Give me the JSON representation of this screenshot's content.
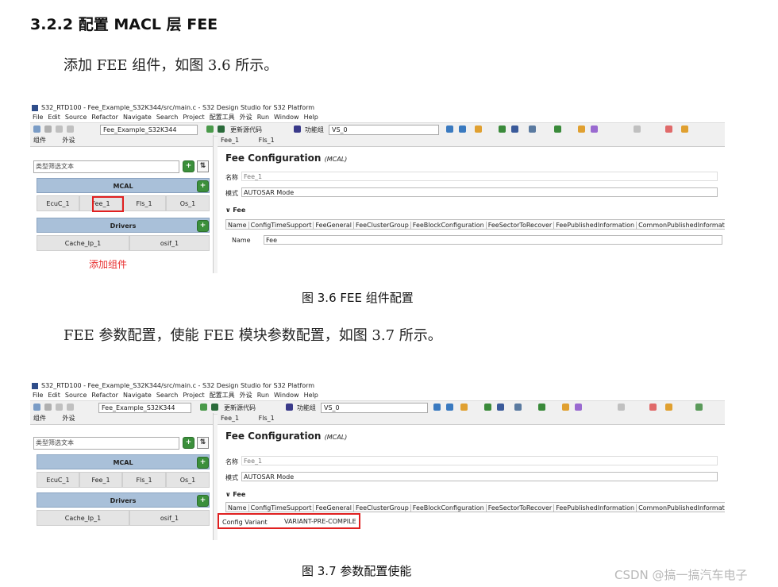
{
  "heading": "3.2.2  配置 MACL 层 FEE",
  "para1": "添加 FEE 组件，如图 3.6 所示。",
  "para2": "FEE 参数配置，使能 FEE 模块参数配置，如图 3.7 所示。",
  "caption1": "图  3.6 FEE 组件配置",
  "caption2": "图  3.7  参数配置使能",
  "watermark": "CSDN @搞一搞汽车电子",
  "ide": {
    "title": "S32_RTD100 - Fee_Example_S32K344/src/main.c - S32 Design Studio for S32 Platform",
    "menus": [
      "File",
      "Edit",
      "Source",
      "Refactor",
      "Navigate",
      "Search",
      "Project",
      "配置工具",
      "外设",
      "Run",
      "Window",
      "Help"
    ],
    "project_combo": "Fee_Example_S32K344",
    "update_code": "更新源代码",
    "func_group_label": "功能组",
    "func_group_value": "VS_0",
    "left_tab1": "组件",
    "left_tab2": "外设",
    "filter_placeholder": "类型筛选文本",
    "group_mcal": "MCAL",
    "mcal_items": [
      "EcuC_1",
      "Fee_1",
      "Fls_1",
      "Os_1"
    ],
    "group_drivers": "Drivers",
    "driver_items": [
      "Cache_Ip_1",
      "osif_1"
    ],
    "add_component": "添加组件",
    "editor_tab1": "Fee_1",
    "editor_tab2": "Fls_1",
    "config_title": "Fee Configuration",
    "config_sub": "(MCAL)",
    "name_label": "名称",
    "name_value": "Fee_1",
    "mode_label": "模式",
    "mode_value": "AUTOSAR Mode",
    "section": "Fee",
    "columns": [
      "Name",
      "ConfigTimeSupport",
      "FeeGeneral",
      "FeeClusterGroup",
      "FeeBlockConfiguration",
      "FeeSectorToRecover",
      "FeePublishedInformation",
      "CommonPublishedInformation"
    ],
    "fig1_row_label": "Name",
    "fig1_row_value": "Fee",
    "fig2_row_label": "Config Variant",
    "fig2_row_value": "VARIANT-PRE-COMPILE"
  }
}
